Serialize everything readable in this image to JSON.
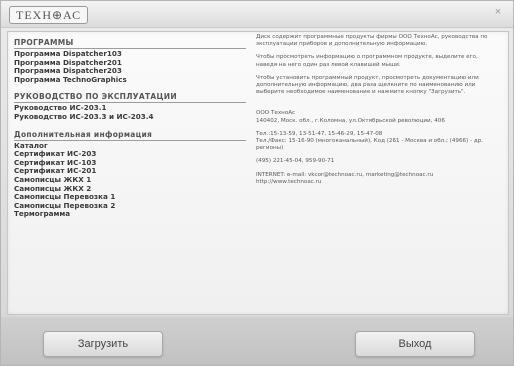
{
  "window": {
    "logo": "ТЕХН⊕АС",
    "close_glyph": "×"
  },
  "left": {
    "sections": [
      {
        "header": "ПРОГРАММЫ",
        "items": [
          "Программа Dispatcher103",
          "Программа Dispatcher201",
          "Программа Dispatcher203",
          "Программа TechnoGraphics"
        ]
      },
      {
        "header": "РУКОВОДСТВО ПО ЭКСПЛУАТАЦИИ",
        "items": [
          "Руководство ИС-203.1",
          "Руководство ИС-203.3 и ИС-203.4"
        ]
      },
      {
        "header": "Дополнительная информация",
        "items": [
          "Каталог",
          "Сертификат ИС-203",
          "Сертификат ИС-103",
          "Сертификат ИС-201",
          "Самописцы ЖКХ 1",
          "Самописцы ЖКХ 2",
          "Самописцы Перевозка 1",
          "Самописцы Перевозка 2",
          "Термограмма"
        ]
      }
    ]
  },
  "right": {
    "intro1": "Диск содержит программные продукты фирмы ООО ТехноАс, руководства по эксплуатации приборов и дополнительную информацию.",
    "intro2": "Чтобы просмотреть информацию о программном продукте, выделите его, наведя на него один раз левой клавишей мыши.",
    "intro3": "Чтобы установить программный продукт, просмотреть документацию или дополнительную информацию, два раза щелкните по наименованию или выберите необходимое наименование и нажмите кнопку \"Загрузить\".",
    "company": "ООО ТехноАс",
    "address": "140402, Моск. обл., г.Коломна, ул.Октябрьской революции, 406",
    "phones": "Тел.:15-13-59, 13-51-47, 15-46-29, 15-47-08",
    "phones2": "Тел./Факс: 15-16-90 (многоканальный), Код (261 - Москва и обл.; (4966) - др. регионы)",
    "phone3": "(495) 221-45-04, 959-90-71",
    "internet": "INTERNET: e-mail: vkcor@technoac.ru, marketing@technoac.ru",
    "web": "http://www.technoac.ru"
  },
  "buttons": {
    "download": "Загрузить",
    "exit": "Выход"
  }
}
